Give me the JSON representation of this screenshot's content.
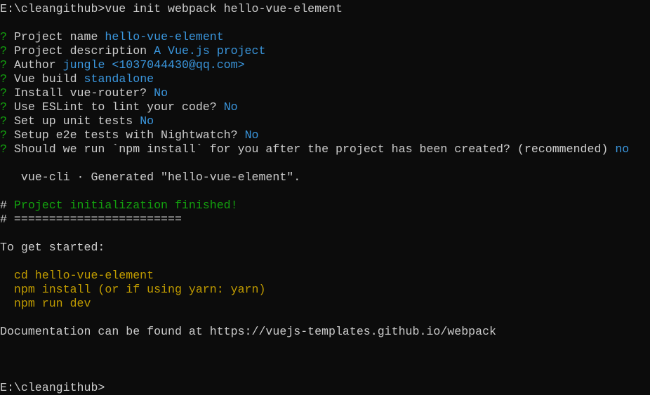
{
  "colors": {
    "background": "#0c0c0c",
    "text": "#cccccc",
    "prompt_mark": "#13a10e",
    "answer": "#3a96dd",
    "success": "#13a10e",
    "command": "#c19c00"
  },
  "command_line": {
    "prompt": "E:\\cleangithub>",
    "command": "vue init webpack hello-vue-element"
  },
  "questions": [
    {
      "q": "Project name",
      "a": "hello-vue-element"
    },
    {
      "q": "Project description",
      "a": "A Vue.js project"
    },
    {
      "q": "Author",
      "a": "jungle <1037044430@qq.com>"
    },
    {
      "q": "Vue build",
      "a": "standalone"
    },
    {
      "q": "Install vue-router?",
      "a": "No"
    },
    {
      "q": "Use ESLint to lint your code?",
      "a": "No"
    },
    {
      "q": "Set up unit tests",
      "a": "No"
    },
    {
      "q": "Setup e2e tests with Nightwatch?",
      "a": "No"
    },
    {
      "q": "Should we run `npm install` for you after the project has been created? (recommended)",
      "a": "no"
    }
  ],
  "question_mark": "?",
  "generated": "   vue-cli · Generated \"hello-vue-element\".",
  "hash": "# ",
  "finished": "Project initialization finished!",
  "rule": "========================",
  "get_started": "To get started:",
  "steps": [
    "  cd hello-vue-element",
    "  npm install (or if using yarn: yarn)",
    "  npm run dev"
  ],
  "documentation": "Documentation can be found at https://vuejs-templates.github.io/webpack",
  "final_prompt": "E:\\cleangithub>"
}
